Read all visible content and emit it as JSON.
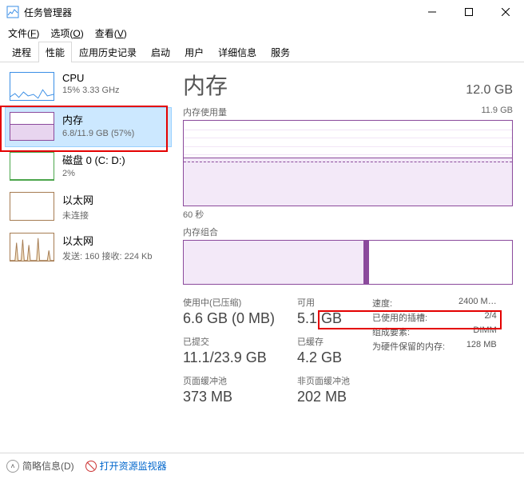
{
  "window": {
    "title": "任务管理器"
  },
  "menu": {
    "file": "文件(",
    "file_u": "F",
    "file_end": ")",
    "options": "选项(",
    "options_u": "O",
    "options_end": ")",
    "view": "查看(",
    "view_u": "V",
    "view_end": ")"
  },
  "tabs": [
    "进程",
    "性能",
    "应用历史记录",
    "启动",
    "用户",
    "详细信息",
    "服务"
  ],
  "sidebar": {
    "cpu": {
      "label": "CPU",
      "sub": "15% 3.33 GHz"
    },
    "memory": {
      "label": "内存",
      "sub": "6.8/11.9 GB (57%)"
    },
    "disk": {
      "label": "磁盘 0 (C: D:)",
      "sub": "2%"
    },
    "eth0": {
      "label": "以太网",
      "sub": "未连接"
    },
    "eth1": {
      "label": "以太网",
      "sub": "发送: 160 接收: 224 Kb"
    }
  },
  "main": {
    "title": "内存",
    "total": "12.0 GB",
    "usage_label": "内存使用量",
    "usage_max": "11.9 GB",
    "axis_seconds": "60 秒",
    "composition_label": "内存组合",
    "stats": {
      "in_use_label": "使用中(已压缩)",
      "in_use_value": "6.6 GB (0 MB)",
      "committed_label": "已提交",
      "committed_value": "11.1/23.9 GB",
      "paged_label": "页面缓冲池",
      "paged_value": "373 MB",
      "available_label": "可用",
      "available_value": "5.1 GB",
      "cached_label": "已缓存",
      "cached_value": "4.2 GB",
      "nonpaged_label": "非页面缓冲池",
      "nonpaged_value": "202 MB"
    },
    "specs": {
      "speed_label": "速度:",
      "speed_value": "2400 M…",
      "slots_label": "已使用的插槽:",
      "slots_value": "2/4",
      "form_label": "组成要素:",
      "form_value": "DIMM",
      "reserved_label": "为硬件保留的内存:",
      "reserved_value": "128 MB"
    }
  },
  "footer": {
    "fewer": "简略信息(",
    "fewer_u": "D",
    "fewer_end": ")",
    "resmon": "打开资源监视器"
  },
  "chart_data": {
    "type": "area",
    "title": "内存使用量",
    "ylim": [
      0,
      11.9
    ],
    "ylabel": "GB",
    "xlabel": "60 秒",
    "series": [
      {
        "name": "in_use",
        "approx_constant": 6.6
      },
      {
        "name": "committed_line",
        "approx_constant": 6.2
      }
    ]
  }
}
